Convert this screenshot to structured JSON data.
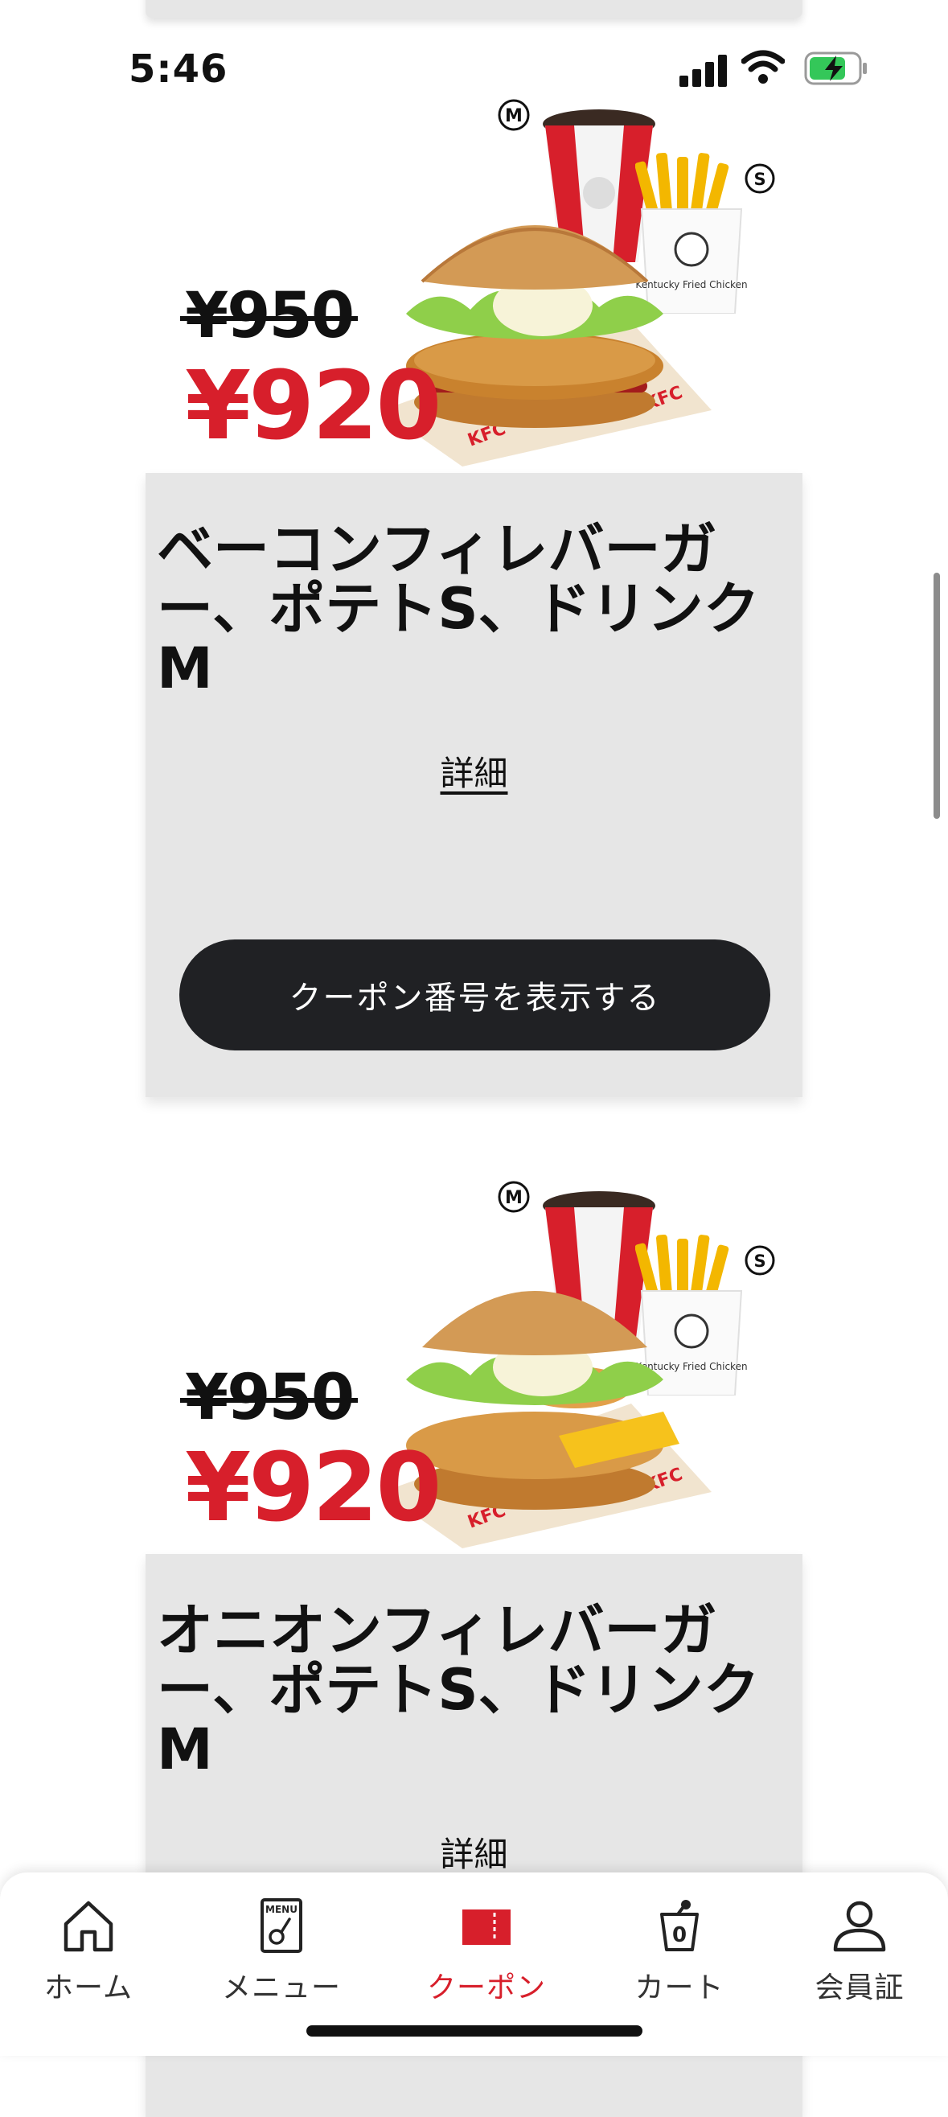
{
  "status_bar": {
    "time": "5:46"
  },
  "coupons": [
    {
      "old_price": "¥950",
      "new_price": "¥920",
      "title": "ベーコンフィレバーガー、ポテトS、ドリンクM",
      "detail_label": "詳細",
      "button_label": "クーポン番号を表示する",
      "size_drink": "M",
      "size_fries": "S",
      "wrapper_text": "KFC",
      "box_text": "Kentucky Fried Chicken"
    },
    {
      "old_price": "¥950",
      "new_price": "¥920",
      "title": "オニオンフィレバーガー、ポテトS、ドリンクM",
      "detail_label": "詳細",
      "size_drink": "M",
      "size_fries": "S",
      "wrapper_text": "KFC",
      "box_text": "Kentucky Fried Chicken"
    }
  ],
  "nav": {
    "items": [
      {
        "label": "ホーム",
        "icon": "home-icon"
      },
      {
        "label": "メニュー",
        "icon": "menu-icon",
        "icon_text": "MENU"
      },
      {
        "label": "クーポン",
        "icon": "coupon-icon",
        "active": true
      },
      {
        "label": "カート",
        "icon": "cart-icon",
        "icon_text": "0"
      },
      {
        "label": "会員証",
        "icon": "member-icon"
      }
    ]
  },
  "colors": {
    "accent": "#d71f2b",
    "button": "#202124",
    "card": "#e6e6e6"
  }
}
